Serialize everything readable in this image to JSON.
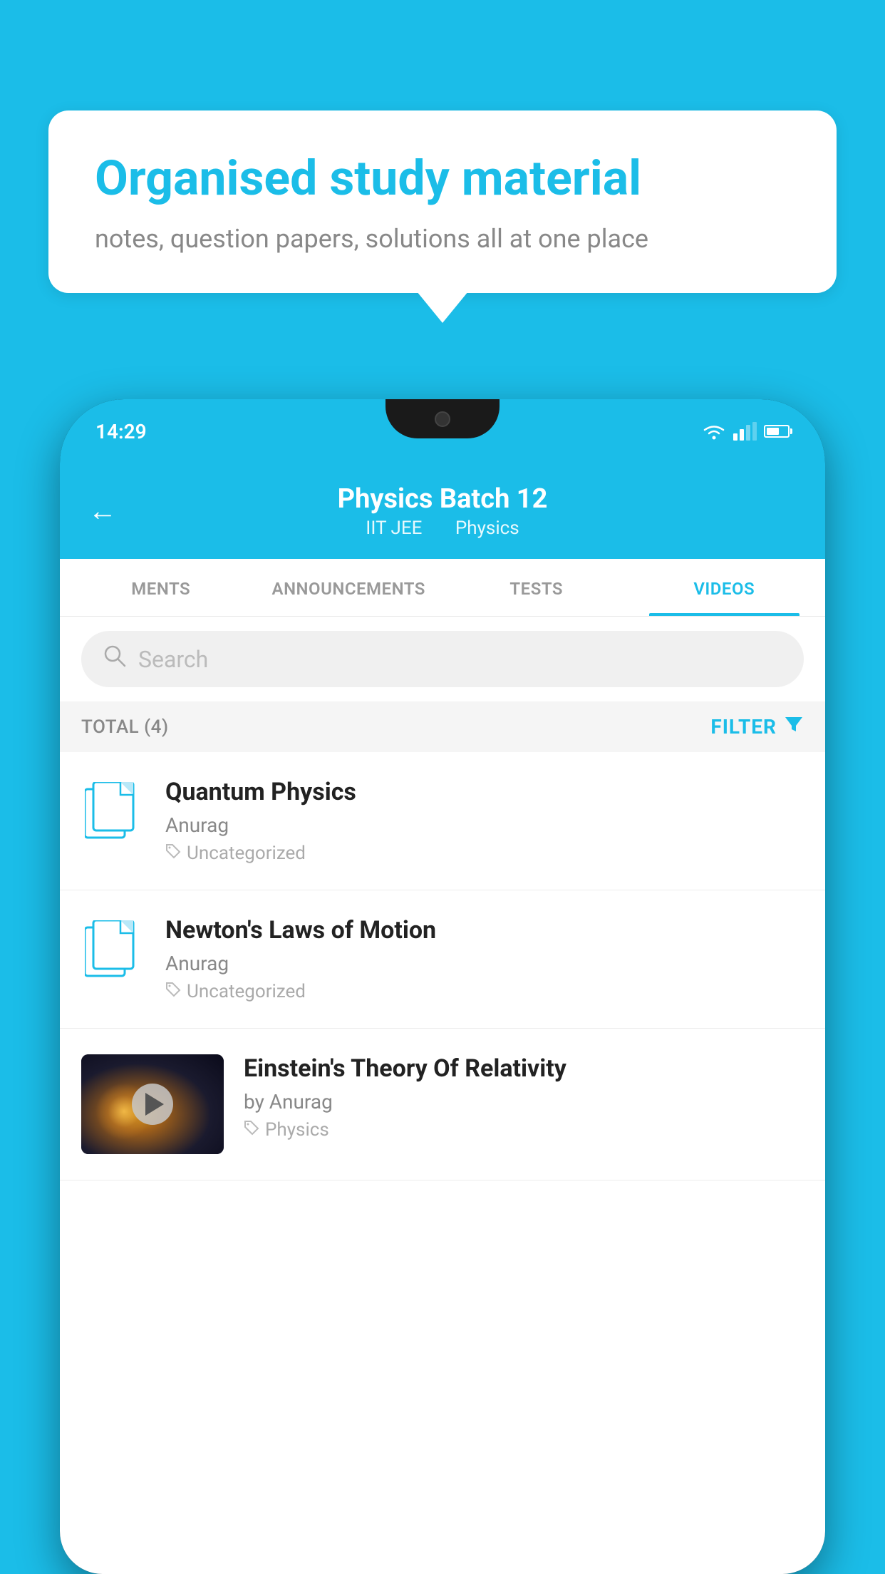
{
  "background_color": "#1bbde8",
  "speech_bubble": {
    "headline": "Organised study material",
    "subtext": "notes, question papers, solutions all at one place"
  },
  "phone": {
    "status_bar": {
      "time": "14:29"
    },
    "app_header": {
      "title": "Physics Batch 12",
      "tag1": "IIT JEE",
      "tag2": "Physics",
      "back_label": "←"
    },
    "tabs": [
      {
        "label": "MENTS",
        "active": false
      },
      {
        "label": "ANNOUNCEMENTS",
        "active": false
      },
      {
        "label": "TESTS",
        "active": false
      },
      {
        "label": "VIDEOS",
        "active": true
      }
    ],
    "search": {
      "placeholder": "Search"
    },
    "filter_row": {
      "total_label": "TOTAL (4)",
      "filter_label": "FILTER"
    },
    "videos": [
      {
        "id": 1,
        "title": "Quantum Physics",
        "author": "Anurag",
        "tag": "Uncategorized",
        "has_thumb": false
      },
      {
        "id": 2,
        "title": "Newton's Laws of Motion",
        "author": "Anurag",
        "tag": "Uncategorized",
        "has_thumb": false
      },
      {
        "id": 3,
        "title": "Einstein's Theory Of Relativity",
        "author": "by Anurag",
        "tag": "Physics",
        "has_thumb": true
      }
    ]
  }
}
